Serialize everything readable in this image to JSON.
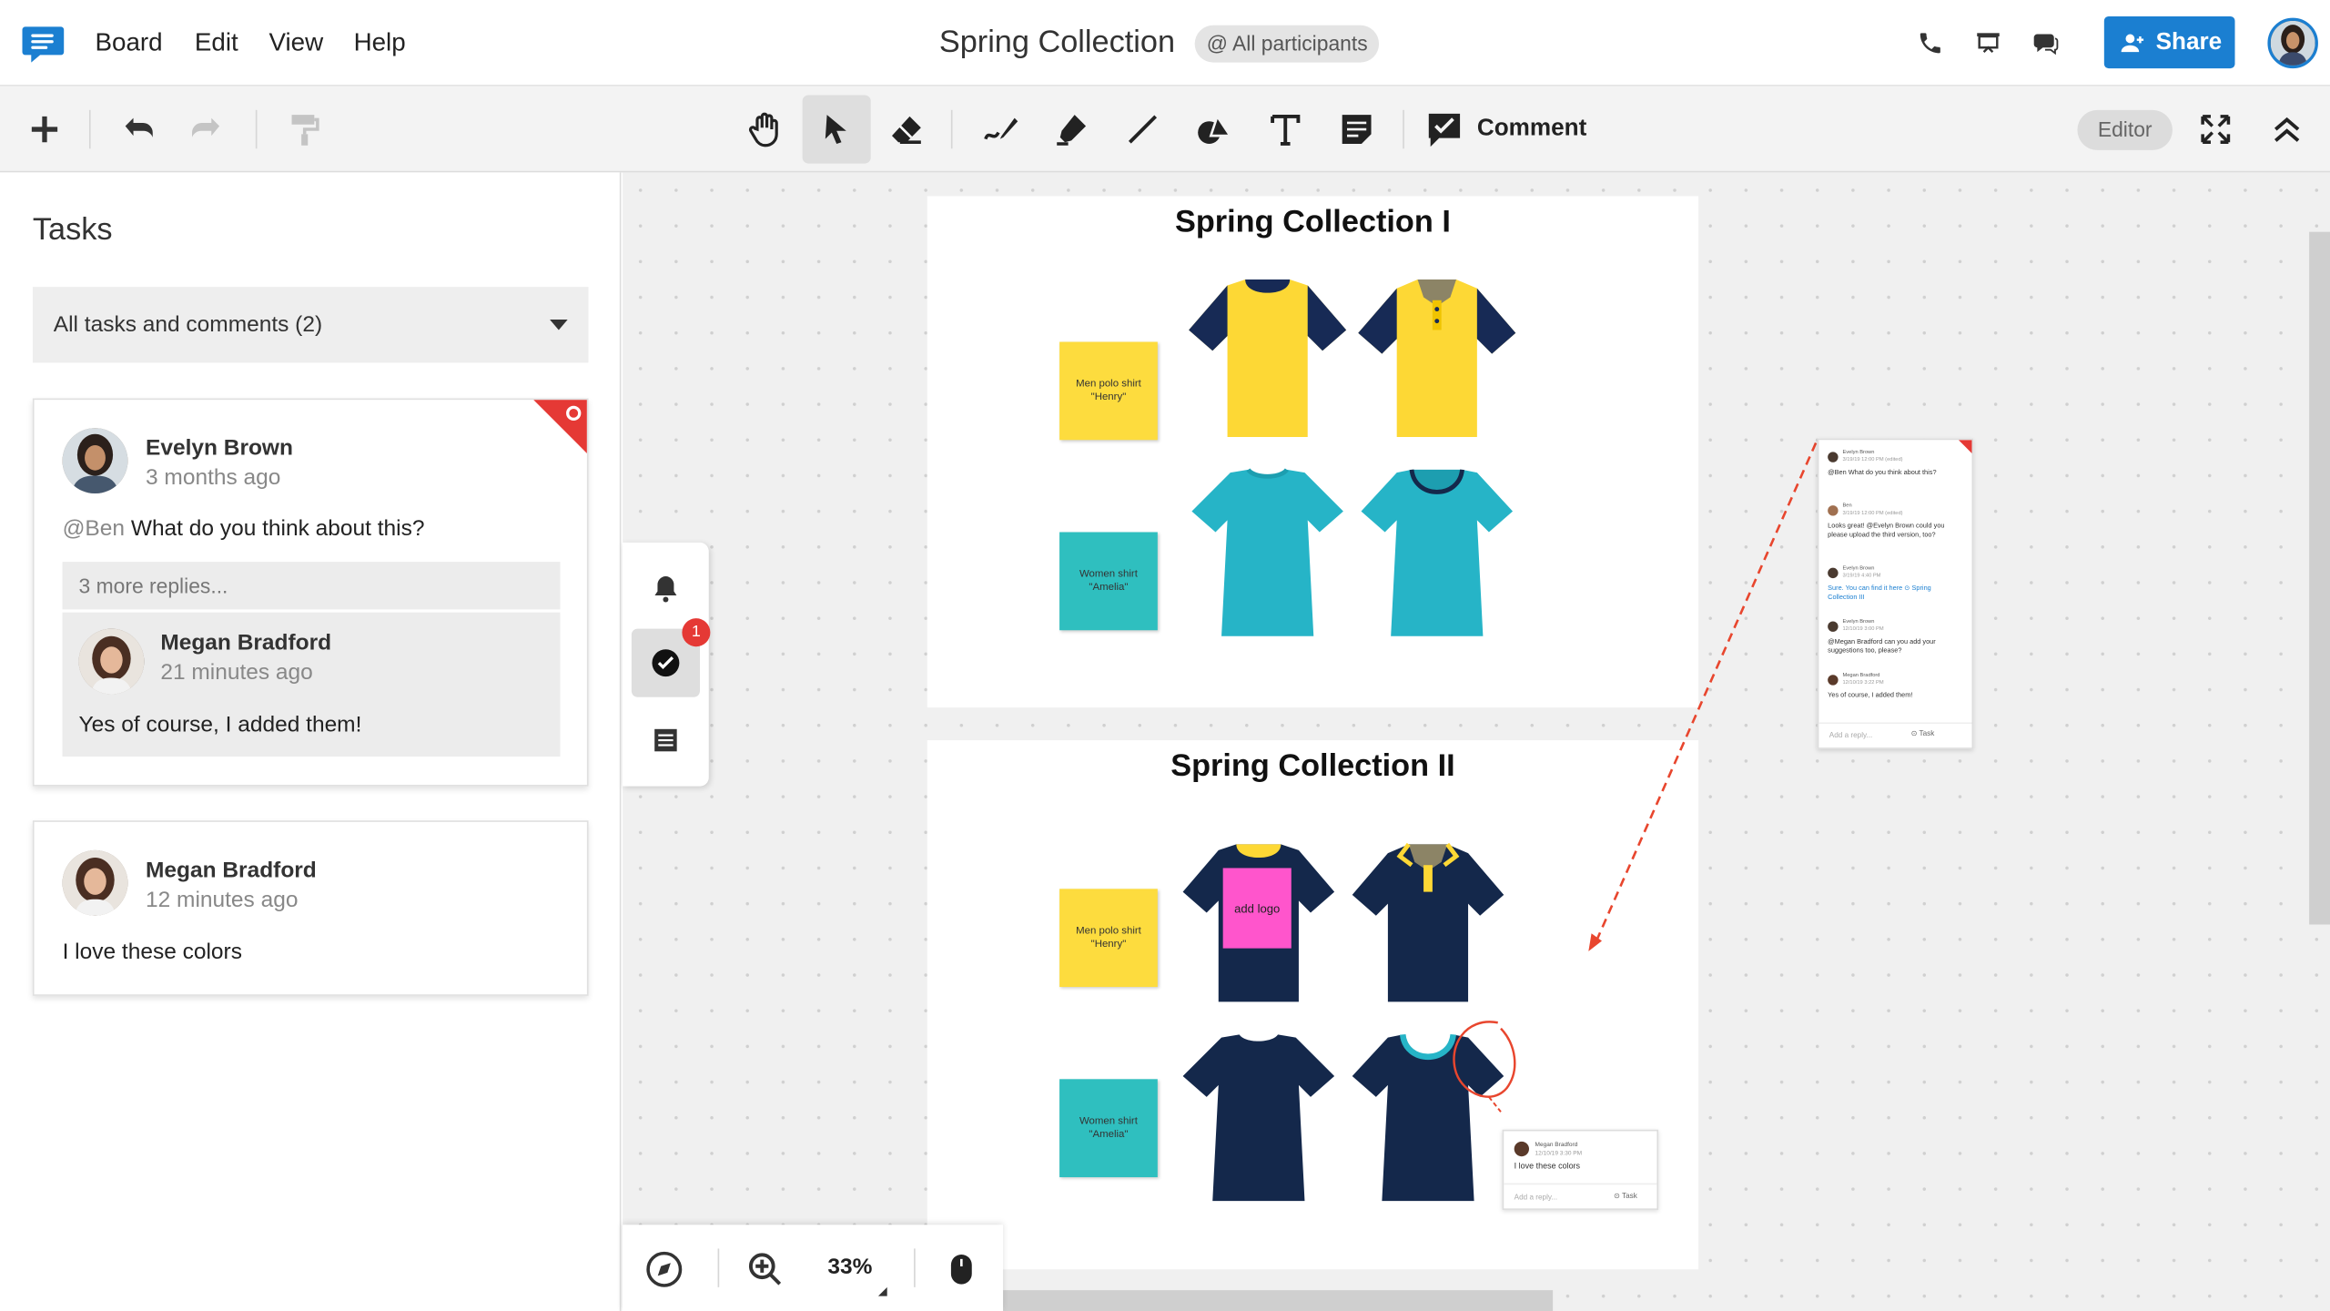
{
  "app": {
    "title": "Spring Collection",
    "participants_badge": "@ All participants",
    "share_label": "Share"
  },
  "menu": {
    "items": [
      "Board",
      "Edit",
      "View",
      "Help"
    ]
  },
  "toolbar": {
    "comment_label": "Comment",
    "editor_label": "Editor"
  },
  "sidebar": {
    "title": "Tasks",
    "filter": "All tasks and comments (2)",
    "cards": [
      {
        "author": "Evelyn Brown",
        "time": "3 months ago",
        "mention": "@Ben",
        "message": "What do you think about this?",
        "more_replies": "3 more replies...",
        "reply": {
          "author": "Megan Bradford",
          "time": "21 minutes ago",
          "message": "Yes of course, I added them!"
        }
      },
      {
        "author": "Megan Bradford",
        "time": "12 minutes ago",
        "message": "I love these colors"
      }
    ]
  },
  "canvas": {
    "frames": [
      {
        "title": "Spring Collection I",
        "sticky_men": "Men polo shirt\n\"Henry\"",
        "sticky_women": "Women shirt\n\"Amelia\""
      },
      {
        "title": "Spring Collection II",
        "sticky_men": "Men polo shirt\n\"Henry\"",
        "sticky_women": "Women shirt\n\"Amelia\"",
        "logo_note": "add logo"
      }
    ],
    "mini_thread": {
      "entries": [
        {
          "author": "Evelyn Brown",
          "time": "3/19/19 12:00 PM (edited)",
          "text": "@Ben What do you think about this?"
        },
        {
          "author": "Ben",
          "time": "3/19/19 12:00 PM (edited)",
          "text": "Looks great! @Evelyn Brown could you please upload the third version, too?"
        },
        {
          "author": "Evelyn Brown",
          "time": "3/19/19 4:40 PM",
          "text": "Sure. You can find it here ⊙ Spring Collection III"
        },
        {
          "author": "Evelyn Brown",
          "time": "12/10/19 3:00 PM",
          "text": "@Megan Bradford can you add your suggestions too, please?"
        },
        {
          "author": "Megan Bradford",
          "time": "12/10/19 3:22 PM",
          "text": "Yes of course, I added them!"
        }
      ],
      "reply_placeholder": "Add a reply...",
      "task_label": "⊙ Task"
    },
    "mini_comment": {
      "author": "Megan Bradford",
      "time": "12/10/19 3:30 PM",
      "text": "I love these colors",
      "reply_placeholder": "Add a reply...",
      "task_label": "⊙ Task"
    }
  },
  "float_tools": {
    "badge_count": "1"
  },
  "zoom": {
    "level": "33%"
  },
  "colors": {
    "accent": "#1b7fd1",
    "shirt_yellow": "#fdd835",
    "shirt_navy": "#14284b",
    "shirt_teal": "#26b4c7",
    "sticky_yellow": "#fddc3e",
    "sticky_teal": "#2fbfbf",
    "logo_pink": "#ff55cc",
    "task_red": "#e53935"
  }
}
